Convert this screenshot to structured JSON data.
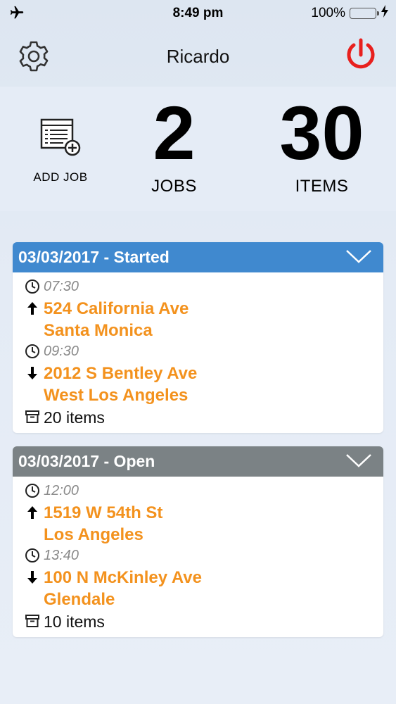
{
  "status_bar": {
    "time": "8:49 pm",
    "battery": "100%"
  },
  "header": {
    "title": "Ricardo"
  },
  "stats": {
    "add_job_label": "ADD JOB",
    "jobs_value": "2",
    "jobs_label": "JOBS",
    "items_value": "30",
    "items_label": "ITEMS"
  },
  "colors": {
    "started": "#4089cf",
    "open": "#7b8285",
    "address": "#f3921e",
    "power": "#e8201e"
  },
  "jobs": [
    {
      "title": "03/03/2017 - Started",
      "status": "started",
      "pickup_time": "07:30",
      "pickup_street": "524 California Ave",
      "pickup_city": "Santa Monica",
      "dropoff_time": "09:30",
      "dropoff_street": "2012 S Bentley Ave",
      "dropoff_city": "West Los Angeles",
      "items": "20 items"
    },
    {
      "title": "03/03/2017 - Open",
      "status": "open",
      "pickup_time": "12:00",
      "pickup_street": "1519 W 54th St",
      "pickup_city": "Los Angeles",
      "dropoff_time": "13:40",
      "dropoff_street": "100 N McKinley Ave",
      "dropoff_city": "Glendale",
      "items": "10 items"
    }
  ]
}
